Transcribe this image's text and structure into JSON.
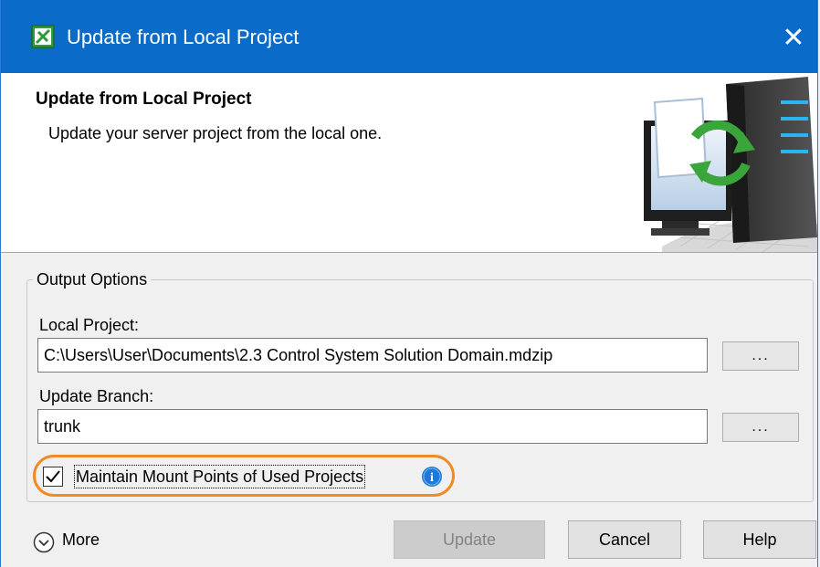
{
  "window": {
    "title": "Update from Local Project",
    "close_glyph": "✕"
  },
  "banner": {
    "heading": "Update from Local Project",
    "description": "Update your server project from the local one.",
    "image_icon": "server-sync-illustration"
  },
  "output_options": {
    "legend": "Output Options",
    "local_project": {
      "label": "Local Project:",
      "value": "C:\\Users\\User\\Documents\\2.3 Control System Solution Domain.mdzip",
      "browse_label": "..."
    },
    "update_branch": {
      "label": "Update Branch:",
      "value": "trunk",
      "browse_label": "..."
    },
    "maintain_mount_points": {
      "label": "Maintain Mount Points of Used Projects",
      "checked": true,
      "check_glyph": "✓",
      "info_glyph": "i"
    }
  },
  "footer": {
    "more_label": "More",
    "update_label": "Update",
    "cancel_label": "Cancel",
    "help_label": "Help"
  },
  "colors": {
    "titlebar": "#0b6bc9",
    "highlight": "#f08a24",
    "info": "#1e78d7"
  }
}
